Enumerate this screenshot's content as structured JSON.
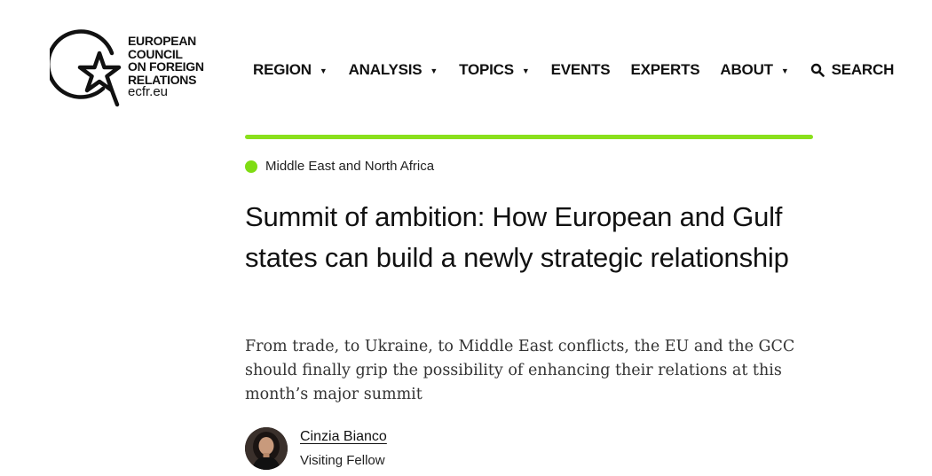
{
  "logo": {
    "lines": [
      "EUROPEAN",
      "COUNCIL",
      "ON FOREIGN",
      "RELATIONS"
    ],
    "domain": "ecfr.eu"
  },
  "nav": {
    "region": "REGION",
    "analysis": "ANALYSIS",
    "topics": "TOPICS",
    "events": "EVENTS",
    "experts": "EXPERTS",
    "about": "ABOUT",
    "search": "SEARCH"
  },
  "article": {
    "category": "Middle East and North Africa",
    "title": "Summit of ambition: How European and Gulf states can build a newly strategic relationship",
    "standfirst": "From trade, to Ukraine, to Middle East conflicts, the EU and the GCC should finally grip the possibility of enhancing their relations at this month’s major summit",
    "author": {
      "name": "Cinzia Bianco",
      "role": "Visiting Fellow"
    }
  },
  "colors": {
    "accent_green": "#8ae01c",
    "text": "#111111"
  },
  "icons": {
    "logo": "star-in-circle-logo-icon",
    "caret": "caret-down-icon",
    "search": "search-icon"
  }
}
